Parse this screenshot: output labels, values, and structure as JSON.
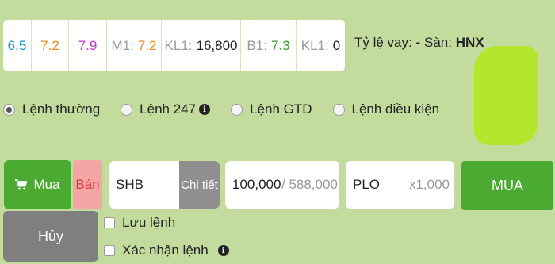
{
  "quote": {
    "ceiling": "6.5",
    "reference": "7.2",
    "floor": "7.9",
    "match_price_label": "M1:",
    "match_price": "7.2",
    "match_volume_label": "KL1:",
    "match_volume": "16,800",
    "bid_label": "B1:",
    "bid_price": "7.3",
    "bid_volume_label": "KL1:",
    "bid_volume": "0"
  },
  "margin": {
    "label": "Tỷ lệ vay:",
    "value": "-"
  },
  "exchange": {
    "label": "Sàn:",
    "value": "HNX"
  },
  "order_types": [
    {
      "label": "Lệnh thường",
      "checked": true,
      "info": false
    },
    {
      "label": "Lệnh 247",
      "checked": false,
      "info": true
    },
    {
      "label": "Lệnh GTD",
      "checked": false,
      "info": false
    },
    {
      "label": "Lệnh điều kiện",
      "checked": false,
      "info": false
    }
  ],
  "order_form": {
    "buy_tab_label": "Mua",
    "sell_tab_label": "Bán",
    "symbol_value": "SHB",
    "detail_label": "Chi tiết",
    "quantity_value": "100,000",
    "max_quantity": "/ 588,000",
    "price_value": "PLO",
    "price_unit": "x1,000",
    "submit_label": "MUA",
    "cancel_label": "Hủy",
    "save_order_label": "Lưu lệnh",
    "confirm_order_label": "Xác nhận lệnh"
  },
  "colors": {
    "background": "#c3dc9d",
    "buy_green": "#4aaa32",
    "sell_pink": "#f6a5a5",
    "ceiling": "#1a8fd0",
    "reference": "#e68a1a",
    "floor": "#cc33cc"
  },
  "icons": [
    "cart-icon",
    "info-icon"
  ]
}
